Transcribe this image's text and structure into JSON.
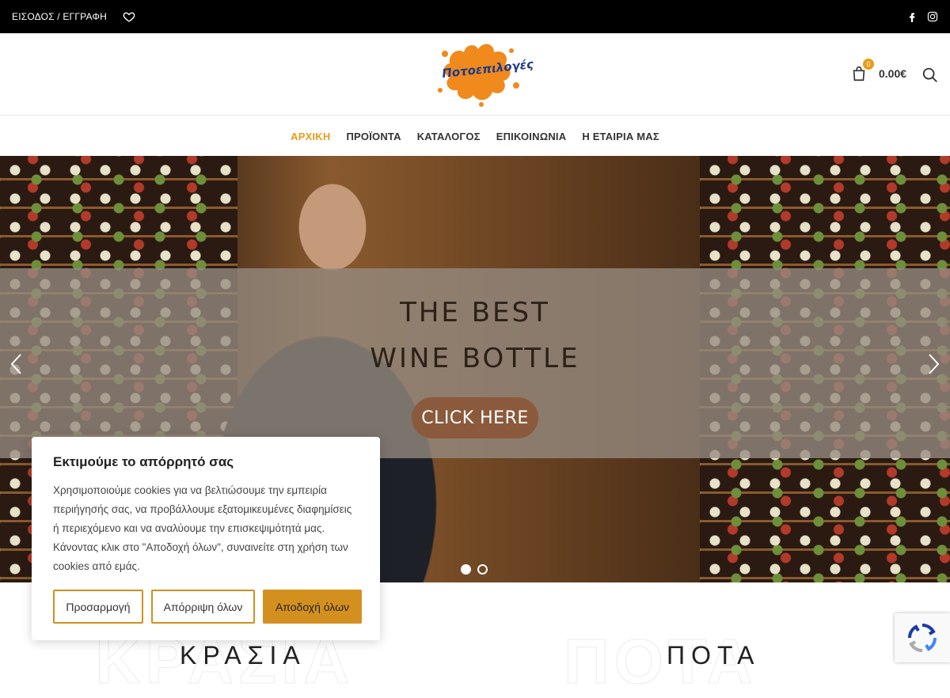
{
  "topbar": {
    "login_label": "ΕΙΣΟΔΟΣ / ΕΓΓΡΑΦΗ",
    "icons": [
      "heart-icon",
      "facebook-icon",
      "instagram-icon"
    ]
  },
  "header": {
    "logo_text": "Ποτοεπιλογές",
    "cart_count": "0",
    "cart_total": "0.00€",
    "accent_color": "#e89c1a"
  },
  "nav": {
    "items": [
      {
        "label": "ΑΡΧΙΚΗ",
        "active": true
      },
      {
        "label": "ΠΡΟΪΟΝΤΑ"
      },
      {
        "label": "ΚΑΤΑΛΟΓΟΣ"
      },
      {
        "label": "ΕΠΙΚΟΙΝΩΝΙΑ"
      },
      {
        "label": "Η ΕΤΑΙΡΙΑ ΜΑΣ"
      }
    ]
  },
  "hero": {
    "title_line1": "THE BEST",
    "title_line2": "WINE BOTTLE",
    "button_label": "CLICK HERE",
    "slide_count": 2,
    "active_slide": 1
  },
  "sections": {
    "wines": "ΚΡΑΣΙΑ",
    "drinks": "ΠΟΤΑ"
  },
  "cookie": {
    "title": "Εκτιμούμε το απόρρητό σας",
    "text": "Χρησιμοποιούμε cookies για να βελτιώσουμε την εμπειρία περιήγησής σας, να προβάλλουμε εξατομικευμένες διαφημίσεις ή περιεχόμενο και να αναλύουμε την επισκεψιμότητά μας. Κάνοντας κλικ στο \"Αποδοχή όλων\", συναινείτε στη χρήση των cookies από εμάς.",
    "customize_label": "Προσαρμογή",
    "reject_label": "Απόρριψη όλων",
    "accept_label": "Αποδοχή όλων",
    "button_color": "#d4901f"
  }
}
